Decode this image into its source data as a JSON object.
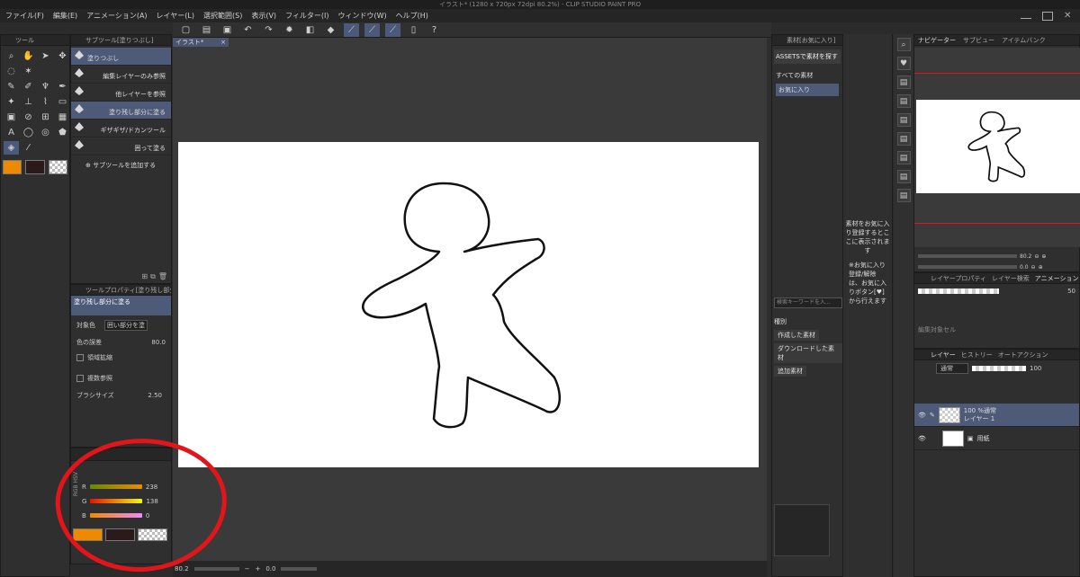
{
  "window": {
    "title": "イラスト* (1280 x 720px 72dpi 80.2%) - CLIP STUDIO PAINT PRO"
  },
  "menu": [
    "ファイル(F)",
    "編集(E)",
    "アニメーション(A)",
    "レイヤー(L)",
    "選択範囲(S)",
    "表示(V)",
    "フィルター(I)",
    "ウィンドウ(W)",
    "ヘルプ(H)"
  ],
  "tool_panel": {
    "title": "ツール"
  },
  "subtool_panel": {
    "title": "サブツール[塗りつぶし]",
    "items": [
      {
        "label": "塗りつぶし",
        "selected": true
      },
      {
        "label": "編集レイヤーのみ参照",
        "selected": false
      },
      {
        "label": "他レイヤーを参照",
        "selected": false
      },
      {
        "label": "塗り残し部分に塗る",
        "selected": true
      },
      {
        "label": "ギザギザ/ドカンツール",
        "selected": false
      },
      {
        "label": "囲って塗る",
        "selected": false
      }
    ],
    "add_label": "サブツールを追加する"
  },
  "tool_property": {
    "title": "ツールプロパティ[塗り残し部分に",
    "preview_label": "塗り残し部分に塗る",
    "target_label": "対象色",
    "target_value": "囲い部分を塗",
    "color_margin_label": "色の誤差",
    "color_margin_value": "80.0",
    "expand_label": "領域拡縮",
    "multi_ref_label": "複数参照",
    "brush_size_label": "ブラシサイズ",
    "brush_size_value": "2.50"
  },
  "color_panel": {
    "mode_labels": [
      "RGB",
      "HSV"
    ],
    "r_label": "R",
    "r_value": "238",
    "g_label": "G",
    "g_value": "138",
    "b_label": "B",
    "b_value": "0"
  },
  "colors": {
    "main": "#ef8a00",
    "sub": "#2a1a1a",
    "annotation": "#e3151a",
    "selection": "#4d5a78"
  },
  "canvas": {
    "tab_label": "イラスト*",
    "zoom_value": "80.2",
    "rotate_value": "0.0"
  },
  "material_panel": {
    "title": "素材[お気に入り]",
    "assets_button": "ASSETSで素材を探す",
    "tree": [
      "すべての素材",
      "お気に入り"
    ],
    "hint": "素材をお気に入り登録するとここに表示されます",
    "hint2": "※お気に入り登録/解除は、お気に入りボタン[♥]から行えます",
    "search_placeholder": "検索キーワードを入...",
    "category_label": "種別",
    "categories": [
      "作成した素材",
      "ダウンロードした素材",
      "追加素材"
    ]
  },
  "navigator": {
    "tabs": [
      "ナビゲーター",
      "サブビュー",
      "アイテムバンク"
    ],
    "zoom_value": "80.2",
    "rotate_value": "0.0",
    "size_value": "50"
  },
  "layer_property": {
    "tabs": [
      "レイヤープロパティ",
      "レイヤー検索",
      "アニメーションセル"
    ],
    "footer_label": "編集対象セル"
  },
  "layer_panel": {
    "tabs": [
      "レイヤー",
      "ヒストリー",
      "オートアクション"
    ],
    "blend_mode": "通常",
    "opacity": "100",
    "layers": [
      {
        "line1": "100 %通常",
        "line2": "レイヤー 1",
        "selected": true
      },
      {
        "line1": "",
        "line2": "用紙",
        "selected": false
      }
    ]
  }
}
